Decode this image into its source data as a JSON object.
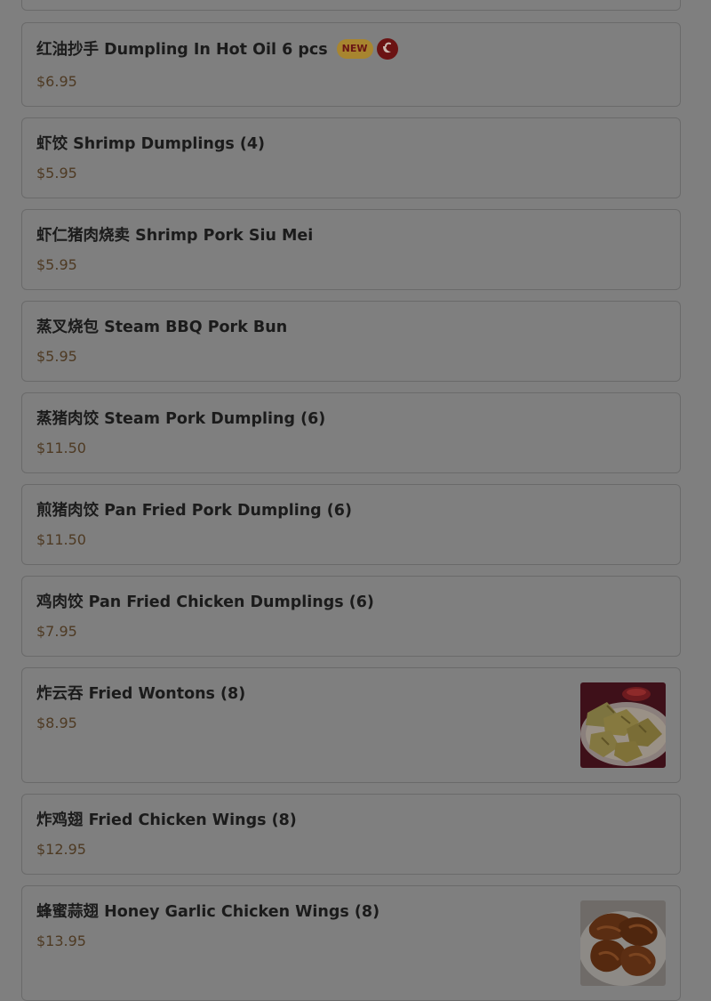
{
  "items": [
    {
      "name": "红油抄手 Dumpling In Hot Oil 6 pcs",
      "price": "$6.95",
      "badge": "NEW",
      "icon": "chili-pepper-icon"
    },
    {
      "name": "虾饺 Shrimp Dumplings (4)",
      "price": "$5.95"
    },
    {
      "name": "虾仁猪肉烧卖 Shrimp Pork Siu Mei",
      "price": "$5.95"
    },
    {
      "name": "蒸叉烧包 Steam BBQ Pork Bun",
      "price": "$5.95"
    },
    {
      "name": "蒸猪肉饺 Steam Pork Dumpling (6)",
      "price": "$11.50"
    },
    {
      "name": "煎猪肉饺 Pan Fried Pork Dumpling (6)",
      "price": "$11.50"
    },
    {
      "name": "鸡肉饺 Pan Fried Chicken Dumplings (6)",
      "price": "$7.95"
    },
    {
      "name": "炸云吞 Fried Wontons (8)",
      "price": "$8.95",
      "image": "fried-wontons-photo"
    },
    {
      "name": "炸鸡翅 Fried Chicken Wings (8)",
      "price": "$12.95"
    },
    {
      "name": "蜂蜜蒜翅 Honey Garlic Chicken Wings (8)",
      "price": "$13.95",
      "image": "honey-garlic-wings-photo"
    }
  ]
}
